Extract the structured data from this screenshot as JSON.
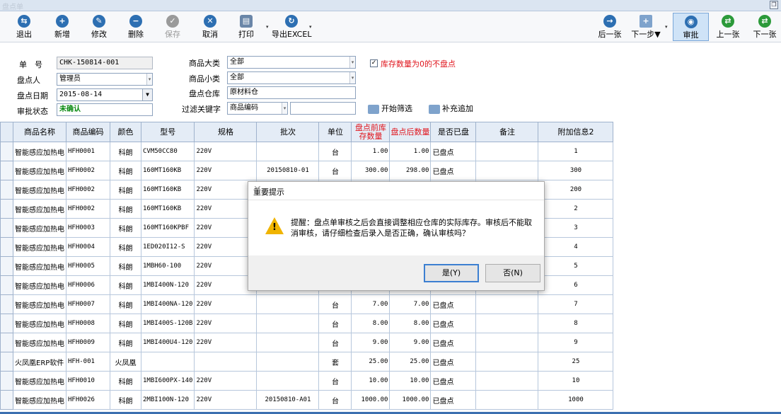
{
  "window": {
    "title": "盘点单",
    "restore_glyph": "❐"
  },
  "toolbar": {
    "exit": "退出",
    "add": "新增",
    "edit": "修改",
    "delete": "删除",
    "save": "保存",
    "cancel": "取消",
    "print": "打印",
    "export": "导出EXCEL",
    "next_sheet": "后一张",
    "next_step": "下一步▼",
    "approve": "审批",
    "prev": "上一张",
    "next": "下一张",
    "dropdown_glyph": "▾"
  },
  "form": {
    "doc_no_label": "单　号",
    "doc_no_value": "CHK-150814-001",
    "counter_label": "盘点人",
    "counter_value": "管理员",
    "date_label": "盘点日期",
    "date_value": "2015-08-14",
    "status_label": "审批状态",
    "status_value": "未确认",
    "category_label": "商品大类",
    "category_value": "全部",
    "subcategory_label": "商品小类",
    "subcategory_value": "全部",
    "warehouse_label": "盘点仓库",
    "warehouse_value": "原材料仓",
    "keyword_label": "过滤关键字",
    "keyword_field_value": "商品编码",
    "keyword_text": "",
    "skip_zero_label": "库存数量为0的不盘点",
    "skip_zero_checked": "✓",
    "filter_button": "开始筛选",
    "append_button": "补充追加"
  },
  "grid": {
    "headers": [
      "商品名称",
      "商品编码",
      "颜色",
      "型号",
      "规格",
      "批次",
      "单位",
      "盘点前库存数量",
      "盘点后数量",
      "是否已盘",
      "备注",
      "附加信息2"
    ],
    "rows": [
      [
        "智能感应加热电",
        "HFH0001",
        "科朗",
        "CVM50CC80",
        "220V",
        "",
        "台",
        "1.00",
        "1.00",
        "已盘点",
        "",
        "1"
      ],
      [
        "智能感应加热电",
        "HFH0002",
        "科朗",
        "160MT160KB",
        "220V",
        "20150810-01",
        "台",
        "300.00",
        "298.00",
        "已盘点",
        "",
        "300"
      ],
      [
        "智能感应加热电",
        "HFH0002",
        "科朗",
        "160MT160KB",
        "220V",
        "",
        "",
        "",
        "",
        "",
        "",
        "200"
      ],
      [
        "智能感应加热电",
        "HFH0002",
        "科朗",
        "160MT160KB",
        "220V",
        "",
        "",
        "",
        "",
        "",
        "",
        "2"
      ],
      [
        "智能感应加热电",
        "HFH0003",
        "科朗",
        "160MT160KPBF",
        "220V",
        "",
        "",
        "",
        "",
        "",
        "",
        "3"
      ],
      [
        "智能感应加热电",
        "HFH0004",
        "科朗",
        "1ED020I12-S",
        "220V",
        "",
        "",
        "",
        "",
        "",
        "",
        "4"
      ],
      [
        "智能感应加热电",
        "HFH0005",
        "科朗",
        "1MBH60-100",
        "220V",
        "",
        "",
        "",
        "",
        "",
        "",
        "5"
      ],
      [
        "智能感应加热电",
        "HFH0006",
        "科朗",
        "1MBI400N-120",
        "220V",
        "",
        "",
        "",
        "",
        "",
        "",
        "6"
      ],
      [
        "智能感应加热电",
        "HFH0007",
        "科朗",
        "1MBI400NA-120",
        "220V",
        "",
        "台",
        "7.00",
        "7.00",
        "已盘点",
        "",
        "7"
      ],
      [
        "智能感应加热电",
        "HFH0008",
        "科朗",
        "1MBI400S-120B",
        "220V",
        "",
        "台",
        "8.00",
        "8.00",
        "已盘点",
        "",
        "8"
      ],
      [
        "智能感应加热电",
        "HFH0009",
        "科朗",
        "1MBI400U4-120",
        "220V",
        "",
        "台",
        "9.00",
        "9.00",
        "已盘点",
        "",
        "9"
      ],
      [
        "火凤凰ERP软件",
        "HFH-001",
        "火凤凰",
        "",
        "",
        "",
        "套",
        "25.00",
        "25.00",
        "已盘点",
        "",
        "25"
      ],
      [
        "智能感应加热电",
        "HFH0010",
        "科朗",
        "1MBI600PX-140",
        "220V",
        "",
        "台",
        "10.00",
        "10.00",
        "已盘点",
        "",
        "10"
      ],
      [
        "智能感应加热电",
        "HFH0026",
        "科朗",
        "2MBI100N-120",
        "220V",
        "20150810-A01",
        "台",
        "1000.00",
        "1000.00",
        "已盘点",
        "",
        "1000"
      ]
    ]
  },
  "dialog": {
    "title": "重要提示",
    "close": "✕",
    "message": "提醒：盘点单审核之后会直接调整相应仓库的实际库存。审核后不能取消审核，请仔细检查后录入是否正确，确认审核吗？",
    "yes": "是(Y)",
    "no": "否(N)",
    "icon": "warning-icon"
  },
  "colors": {
    "accent": "#2d6fb2",
    "status_green": "#0a8a12",
    "warning_red": "#e0141c"
  }
}
